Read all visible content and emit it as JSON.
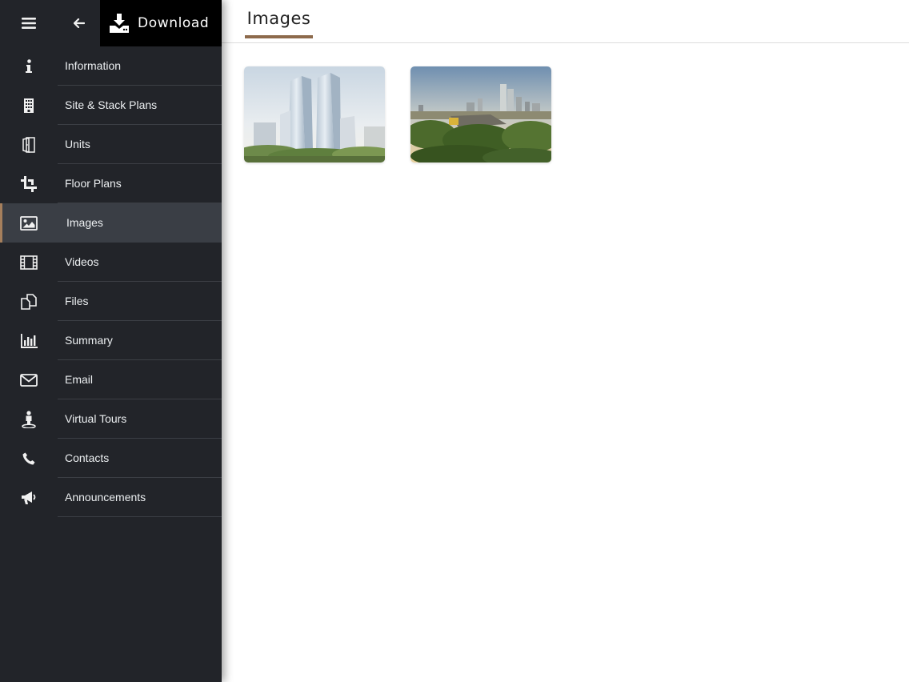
{
  "topbar": {
    "menu_icon": "hamburger-menu-icon",
    "back_icon": "arrow-left-icon",
    "download_icon": "download-tray-icon",
    "download_label": "Download"
  },
  "sidebar": {
    "accent_color": "#a57f5c",
    "items": [
      {
        "label": "Information",
        "icon": "info-icon",
        "active": false
      },
      {
        "label": "Site & Stack Plans",
        "icon": "building-icon",
        "active": false
      },
      {
        "label": "Units",
        "icon": "door-icon",
        "active": false
      },
      {
        "label": "Floor Plans",
        "icon": "crop-icon",
        "active": false
      },
      {
        "label": "Images",
        "icon": "image-icon",
        "active": true
      },
      {
        "label": "Videos",
        "icon": "film-icon",
        "active": false
      },
      {
        "label": "Files",
        "icon": "files-icon",
        "active": false
      },
      {
        "label": "Summary",
        "icon": "bar-chart-icon",
        "active": false
      },
      {
        "label": "Email",
        "icon": "envelope-icon",
        "active": false
      },
      {
        "label": "Virtual Tours",
        "icon": "street-view-icon",
        "active": false
      },
      {
        "label": "Contacts",
        "icon": "phone-icon",
        "active": false
      },
      {
        "label": "Announcements",
        "icon": "megaphone-icon",
        "active": false
      }
    ]
  },
  "main": {
    "tab_label": "Images",
    "tab_underline_color": "#8d6a4c",
    "images": [
      {
        "name": "tower-render-thumbnail"
      },
      {
        "name": "city-aerial-thumbnail"
      }
    ]
  }
}
